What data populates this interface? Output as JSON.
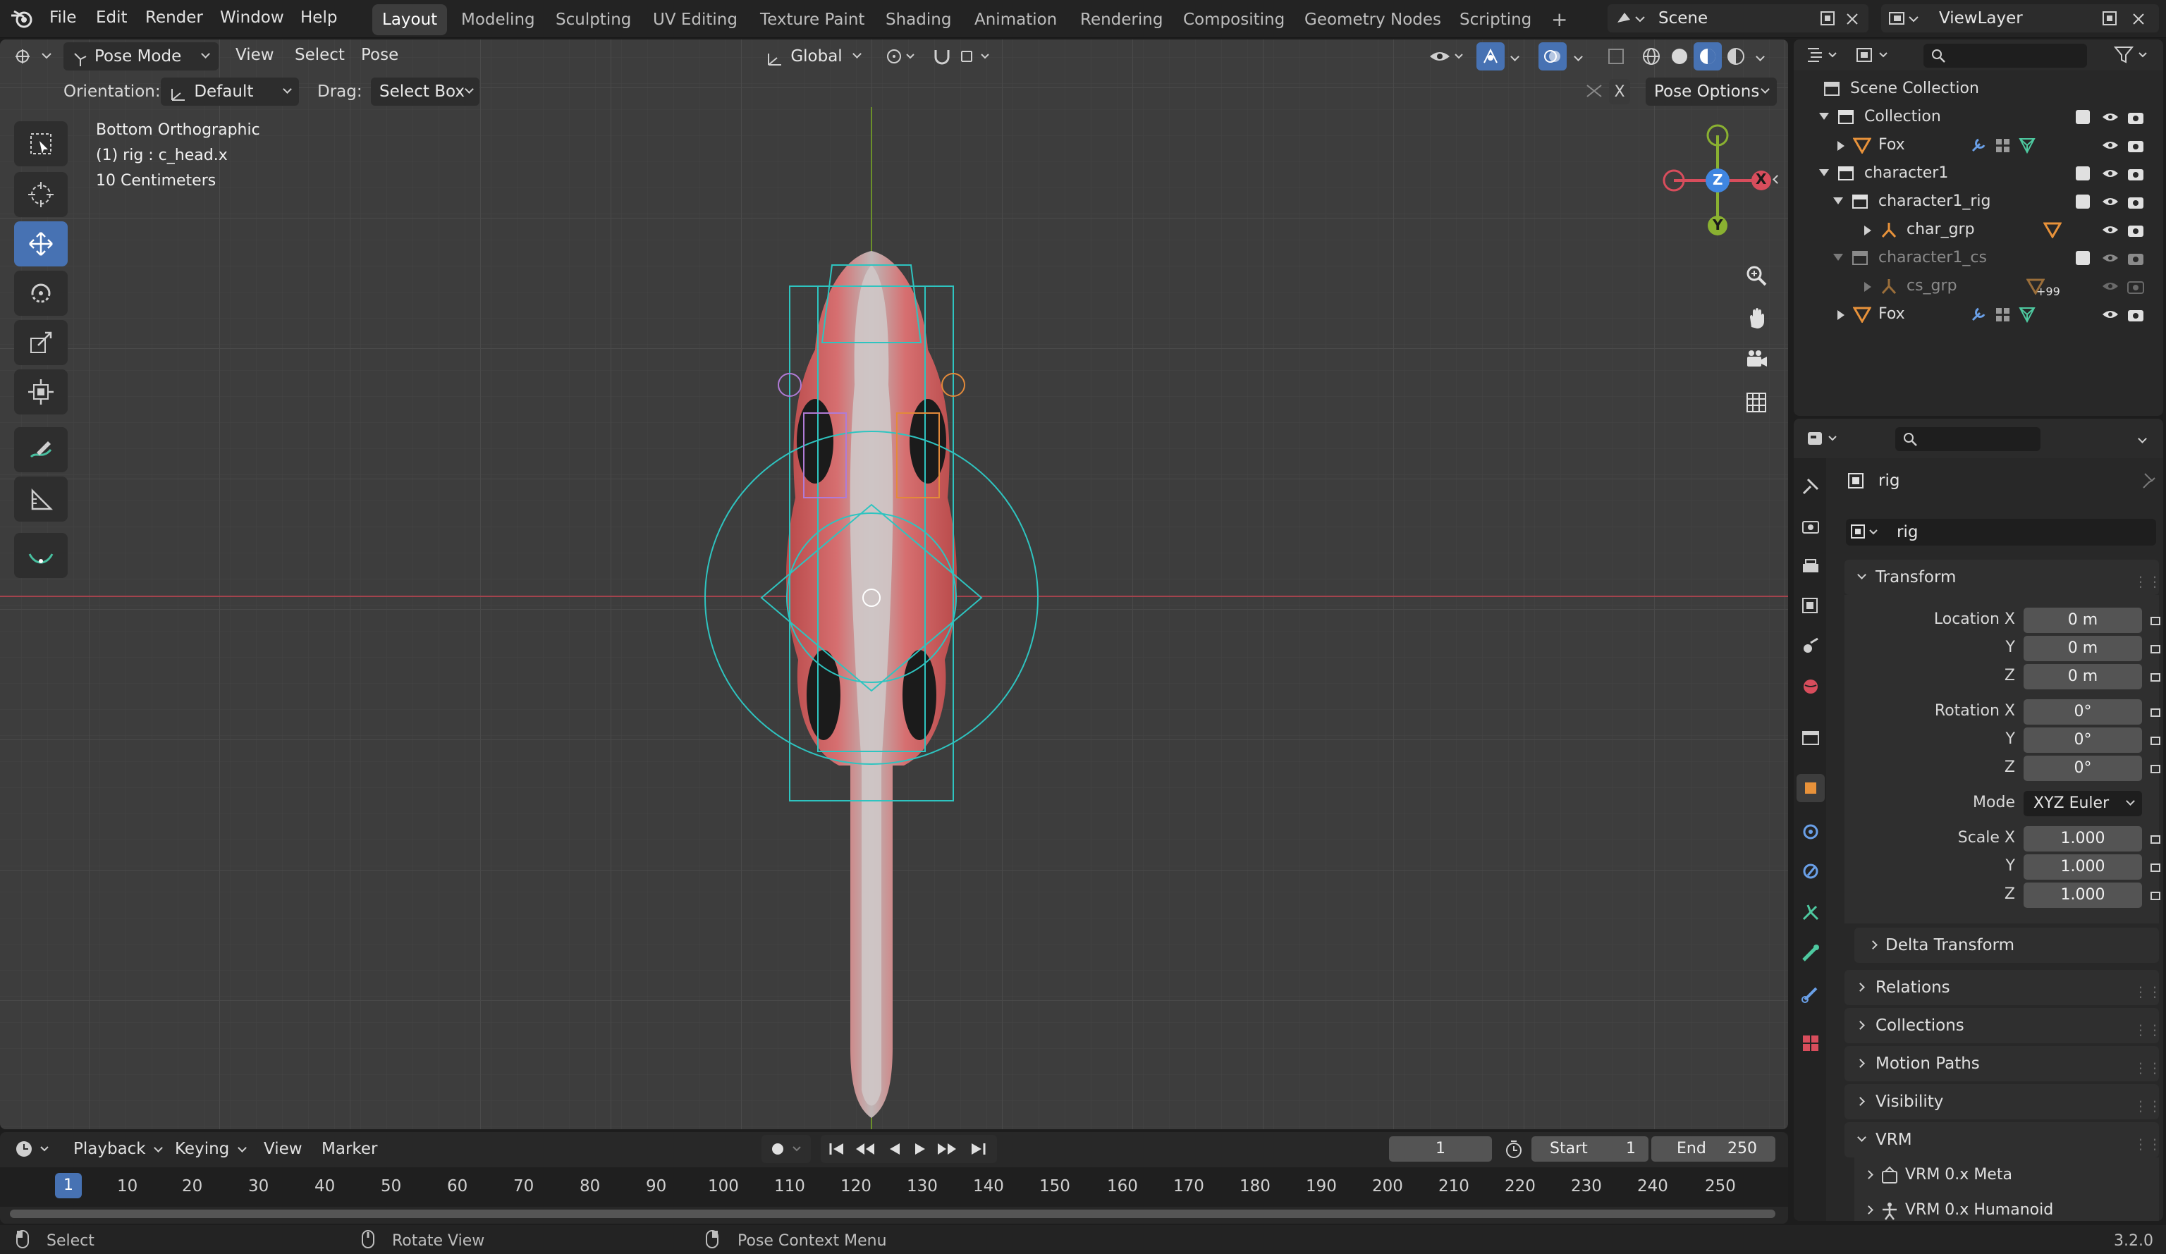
{
  "menu": [
    "File",
    "Edit",
    "Render",
    "Window",
    "Help"
  ],
  "workspaces": [
    "Layout",
    "Modeling",
    "Sculpting",
    "UV Editing",
    "Texture Paint",
    "Shading",
    "Animation",
    "Rendering",
    "Compositing",
    "Geometry Nodes",
    "Scripting"
  ],
  "workspace_add": "+",
  "scene_name": "Scene",
  "view_layer": "ViewLayer",
  "viewport": {
    "mode": "Pose Mode",
    "menus": [
      "View",
      "Select",
      "Pose"
    ],
    "transform_orientation": "Global",
    "orientation_label": "Orientation:",
    "orientation_value": "Default",
    "drag_label": "Drag:",
    "drag_value": "Select Box",
    "pose_options": "Pose Options",
    "x_mirror": "X",
    "view_name": "Bottom Orthographic",
    "active_object": "(1) rig : c_head.x",
    "grid_scale": "10 Centimeters",
    "gizmo": {
      "z": "Z",
      "y": "Y",
      "x": "X"
    }
  },
  "outliner": {
    "scene_collection": "Scene Collection",
    "rows": [
      "Collection",
      "Fox",
      "character1",
      "character1_rig",
      "char_grp",
      "character1_cs",
      "cs_grp",
      "Fox"
    ],
    "cs_badge": "+99"
  },
  "properties": {
    "object_name": "rig",
    "object_data_name": "rig",
    "transform_title": "Transform",
    "location_label": "Location X",
    "loc": [
      "0 m",
      "0 m",
      "0 m"
    ],
    "rotation_label": "Rotation X",
    "rot": [
      "0°",
      "0°",
      "0°"
    ],
    "mode_label": "Mode",
    "mode_value": "XYZ Euler",
    "scale_label": "Scale X",
    "scale": [
      "1.000",
      "1.000",
      "1.000"
    ],
    "y_label": "Y",
    "z_label": "Z",
    "delta_transform": "Delta Transform",
    "panels": [
      "Relations",
      "Collections",
      "Motion Paths",
      "Visibility",
      "VRM"
    ],
    "vrm_items": [
      "VRM 0.x Meta",
      "VRM 0.x Humanoid"
    ]
  },
  "timeline": {
    "menus": [
      "Playback",
      "Keying",
      "View",
      "Marker"
    ],
    "current_frame": "1",
    "start_label": "Start",
    "start_value": "1",
    "end_label": "End",
    "end_value": "250",
    "frames": [
      "1",
      "10",
      "20",
      "30",
      "40",
      "50",
      "60",
      "70",
      "80",
      "90",
      "100",
      "110",
      "120",
      "130",
      "140",
      "150",
      "160",
      "170",
      "180",
      "190",
      "200",
      "210",
      "220",
      "230",
      "240",
      "250"
    ]
  },
  "status": {
    "select": "Select",
    "rotate": "Rotate View",
    "context": "Pose Context Menu",
    "version": "3.2.0"
  },
  "colors": {
    "accent": "#4772b3",
    "x_axis": "#d84d5c",
    "y_axis": "#8ab131",
    "z_axis": "#3f86e1",
    "bone_wire": "#2ec4c0"
  }
}
